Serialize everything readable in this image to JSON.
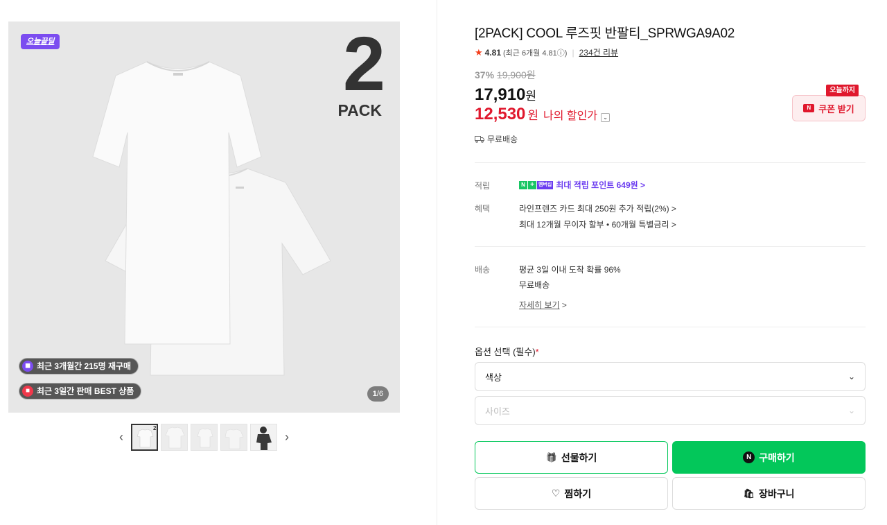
{
  "gallery": {
    "deal_badge": "오늘끝딜",
    "pack_number": "2",
    "pack_word": "PACK",
    "pill_repurchase": "최근 3개월간 215명 재구매",
    "pill_best": "최근 3일간 판매 BEST 상품",
    "pager_current": "1",
    "pager_total": "/6",
    "prev_arrow": "‹",
    "next_arrow": "›",
    "thumb_count": 5
  },
  "product": {
    "title": "[2PACK] COOL 루즈핏 반팔티_SPRWGA9A02",
    "rating_star": "★",
    "rating_score": "4.81",
    "rating_recent": "(최근 6개월 4.81ⓘ)",
    "rating_sep": "|",
    "review_count": "234건 리뷰",
    "discount_rate": "37%",
    "original_price": "19,900원",
    "price": "17,910",
    "price_unit": "원",
    "my_price": "12,530",
    "my_price_unit": "원",
    "my_price_label": "나의 할인가",
    "my_price_toggle": "⌄",
    "coupon_tag": "오늘까지",
    "coupon_logo": "N",
    "coupon_label": "쿠폰 받기",
    "shipping_free": "무료배송"
  },
  "benefits": {
    "points_label": "적립",
    "points_n": "N",
    "points_plus": "+",
    "points_member": "멤버십",
    "points_text": "최대 적립 포인트 649원 >",
    "benefit_label": "혜택",
    "benefit_line1": "라인프렌즈 카드 최대 250원 추가 적립(2%) >",
    "benefit_line2": "최대 12개월 무이자 할부 • 60개월 특별금리 >"
  },
  "delivery": {
    "label": "배송",
    "line1": "평균 3일 이내 도착 확률 96%",
    "line2": "무료배송",
    "detail_link": "자세히 보기",
    "detail_arrow": ">"
  },
  "options": {
    "title": "옵션 선택 (필수)",
    "required_mark": "*",
    "color_label": "색상",
    "size_label": "사이즈",
    "caret": "⌄"
  },
  "actions": {
    "gift_icon": "🎁",
    "gift_label": "선물하기",
    "buy_logo": "N",
    "buy_label": "구매하기",
    "wish_icon": "♡",
    "wish_label": "찜하기",
    "cart_icon": "🛍",
    "cart_label": "장바구니"
  },
  "colors": {
    "naver_green": "#03c75a",
    "sale_red": "#e0182d",
    "deal_purple": "#7b4cf0"
  }
}
